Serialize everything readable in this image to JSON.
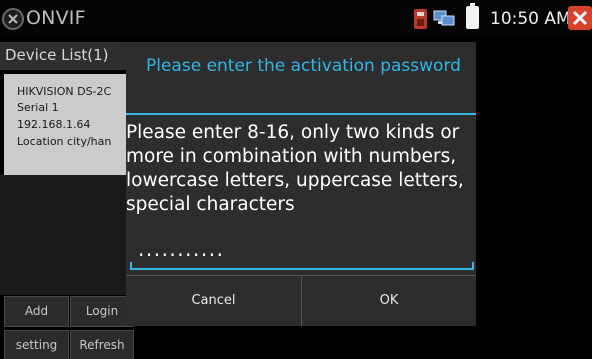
{
  "app": {
    "title": "ONVIF",
    "icon": "camera-onvif-icon"
  },
  "status_bar": {
    "time": "10:50 AM",
    "icons": [
      "sim-card-icon",
      "network-icon",
      "battery-icon",
      "close-icon"
    ]
  },
  "device_list": {
    "header": "Device List(1)",
    "items": [
      {
        "name": "HIKVISION DS-2C",
        "serial": "Serial  1",
        "ip": "192.168.1.64",
        "location": "Location  city/han"
      }
    ]
  },
  "buttons": {
    "add": "Add",
    "login": "Login",
    "setting": "setting",
    "refresh": "Refresh"
  },
  "dialog": {
    "title": "Please enter the activation password",
    "message": "Please enter 8-16, only two kinds or more in combination with numbers, lowercase letters, uppercase letters, special characters",
    "password_value": "...........",
    "cancel_label": "Cancel",
    "ok_label": "OK"
  },
  "colors": {
    "accent": "#33b5e5",
    "dialog_bg": "#2d2d2d",
    "close": "#d8412a"
  }
}
